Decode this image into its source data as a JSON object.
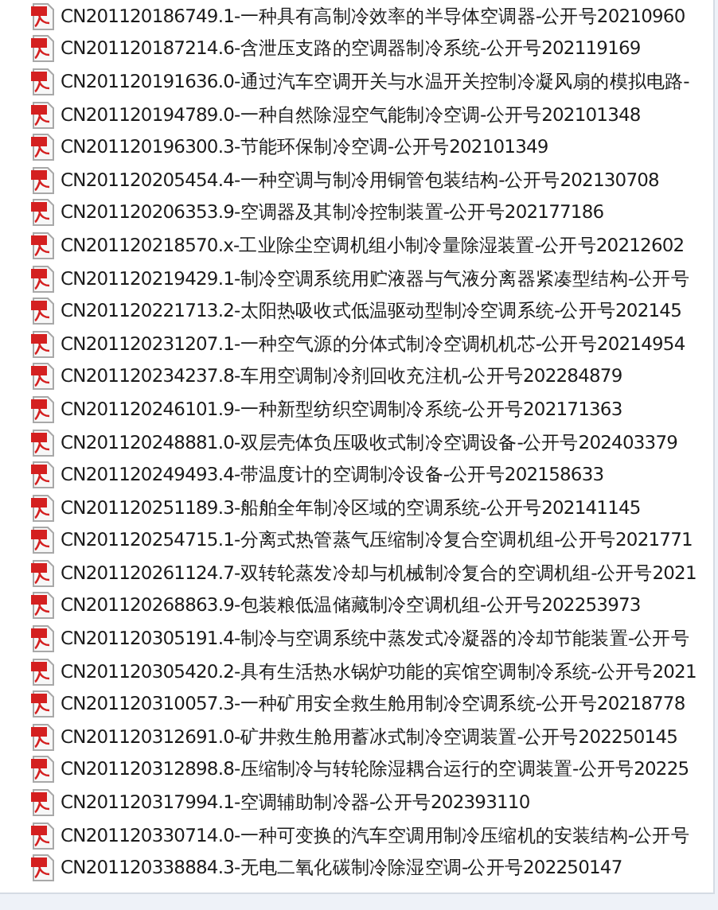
{
  "files": [
    {
      "name": "CN201120186749.1-一种具有高制冷效率的半导体空调器-公开号20210960"
    },
    {
      "name": "CN201120187214.6-含泄压支路的空调器制冷系统-公开号202119169"
    },
    {
      "name": "CN201120191636.0-通过汽车空调开关与水温开关控制冷凝风扇的模拟电路-"
    },
    {
      "name": "CN201120194789.0-一种自然除湿空气能制冷空调-公开号202101348"
    },
    {
      "name": "CN201120196300.3-节能环保制冷空调-公开号202101349"
    },
    {
      "name": "CN201120205454.4-一种空调与制冷用铜管包装结构-公开号202130708"
    },
    {
      "name": "CN201120206353.9-空调器及其制冷控制装置-公开号202177186"
    },
    {
      "name": "CN201120218570.x-工业除尘空调机组小制冷量除湿装置-公开号20212602"
    },
    {
      "name": "CN201120219429.1-制冷空调系统用贮液器与气液分离器紧凑型结构-公开号"
    },
    {
      "name": "CN201120221713.2-太阳热吸收式低温驱动型制冷空调系统-公开号202145"
    },
    {
      "name": "CN201120231207.1-一种空气源的分体式制冷空调机机芯-公开号20214954"
    },
    {
      "name": "CN201120234237.8-车用空调制冷剂回收充注机-公开号202284879"
    },
    {
      "name": "CN201120246101.9-一种新型纺织空调制冷系统-公开号202171363"
    },
    {
      "name": "CN201120248881.0-双层壳体负压吸收式制冷空调设备-公开号202403379"
    },
    {
      "name": "CN201120249493.4-带温度计的空调制冷设备-公开号202158633"
    },
    {
      "name": "CN201120251189.3-船舶全年制冷区域的空调系统-公开号202141145"
    },
    {
      "name": "CN201120254715.1-分离式热管蒸气压缩制冷复合空调机组-公开号2021771"
    },
    {
      "name": "CN201120261124.7-双转轮蒸发冷却与机械制冷复合的空调机组-公开号2021"
    },
    {
      "name": "CN201120268863.9-包装粮低温储藏制冷空调机组-公开号202253973"
    },
    {
      "name": "CN201120305191.4-制冷与空调系统中蒸发式冷凝器的冷却节能装置-公开号"
    },
    {
      "name": "CN201120305420.2-具有生活热水锅炉功能的宾馆空调制冷系统-公开号2021"
    },
    {
      "name": "CN201120310057.3-一种矿用安全救生舱用制冷空调系统-公开号20218778"
    },
    {
      "name": "CN201120312691.0-矿井救生舱用蓄冰式制冷空调装置-公开号202250145"
    },
    {
      "name": "CN201120312898.8-压缩制冷与转轮除湿耦合运行的空调装置-公开号20225"
    },
    {
      "name": "CN201120317994.1-空调辅助制冷器-公开号202393110"
    },
    {
      "name": "CN201120330714.0-一种可变换的汽车空调用制冷压缩机的安装结构-公开号"
    },
    {
      "name": "CN201120338884.3-无电二氧化碳制冷除湿空调-公开号202250147"
    }
  ]
}
